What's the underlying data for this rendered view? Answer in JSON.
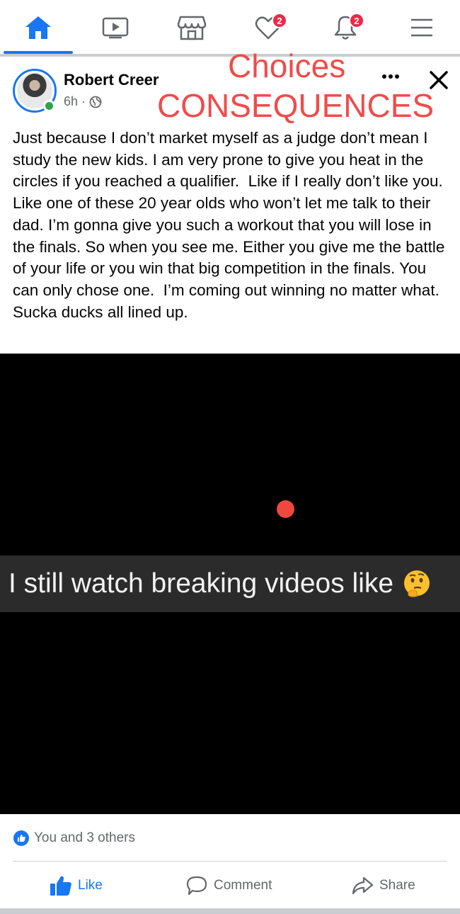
{
  "nav": {
    "items": [
      {
        "name": "home",
        "badge": ""
      },
      {
        "name": "watch",
        "badge": ""
      },
      {
        "name": "marketplace",
        "badge": ""
      },
      {
        "name": "dating",
        "badge": "2"
      },
      {
        "name": "notifications",
        "badge": "2"
      },
      {
        "name": "menu",
        "badge": ""
      }
    ],
    "active_color": "#1877f2"
  },
  "post": {
    "author": "Robert Creer",
    "time": "6h",
    "time_separator": "·",
    "privacy_icon": "globe-icon",
    "overlay_line1": "Choices",
    "overlay_line2": "CONSEQUENCES",
    "body": "Just because I don’t market myself as a judge don’t mean I study the new kids. I am very prone to give you heat in the circles if you reached a qualifier.  Like if I really don’t like you. Like one of these 20 year olds who won’t let me talk to their dad. I’m gonna give you such a workout that you will lose in the finals. So when you see me. Either you give me the battle of your life or you win that big competition in the finals. You can only chose one.  I’m coming out winning no matter what. Sucka ducks all lined up.",
    "video_caption": "I still watch breaking videos like",
    "caption_emoji": "thinking-face-emoji",
    "reactions_text": "You and 3 others",
    "actions": {
      "like": "Like",
      "comment": "Comment",
      "share": "Share"
    }
  },
  "colors": {
    "brand": "#1877f2",
    "overlay_red": "#f04b4b",
    "online_green": "#31a24c",
    "badge_red": "#f02849"
  }
}
